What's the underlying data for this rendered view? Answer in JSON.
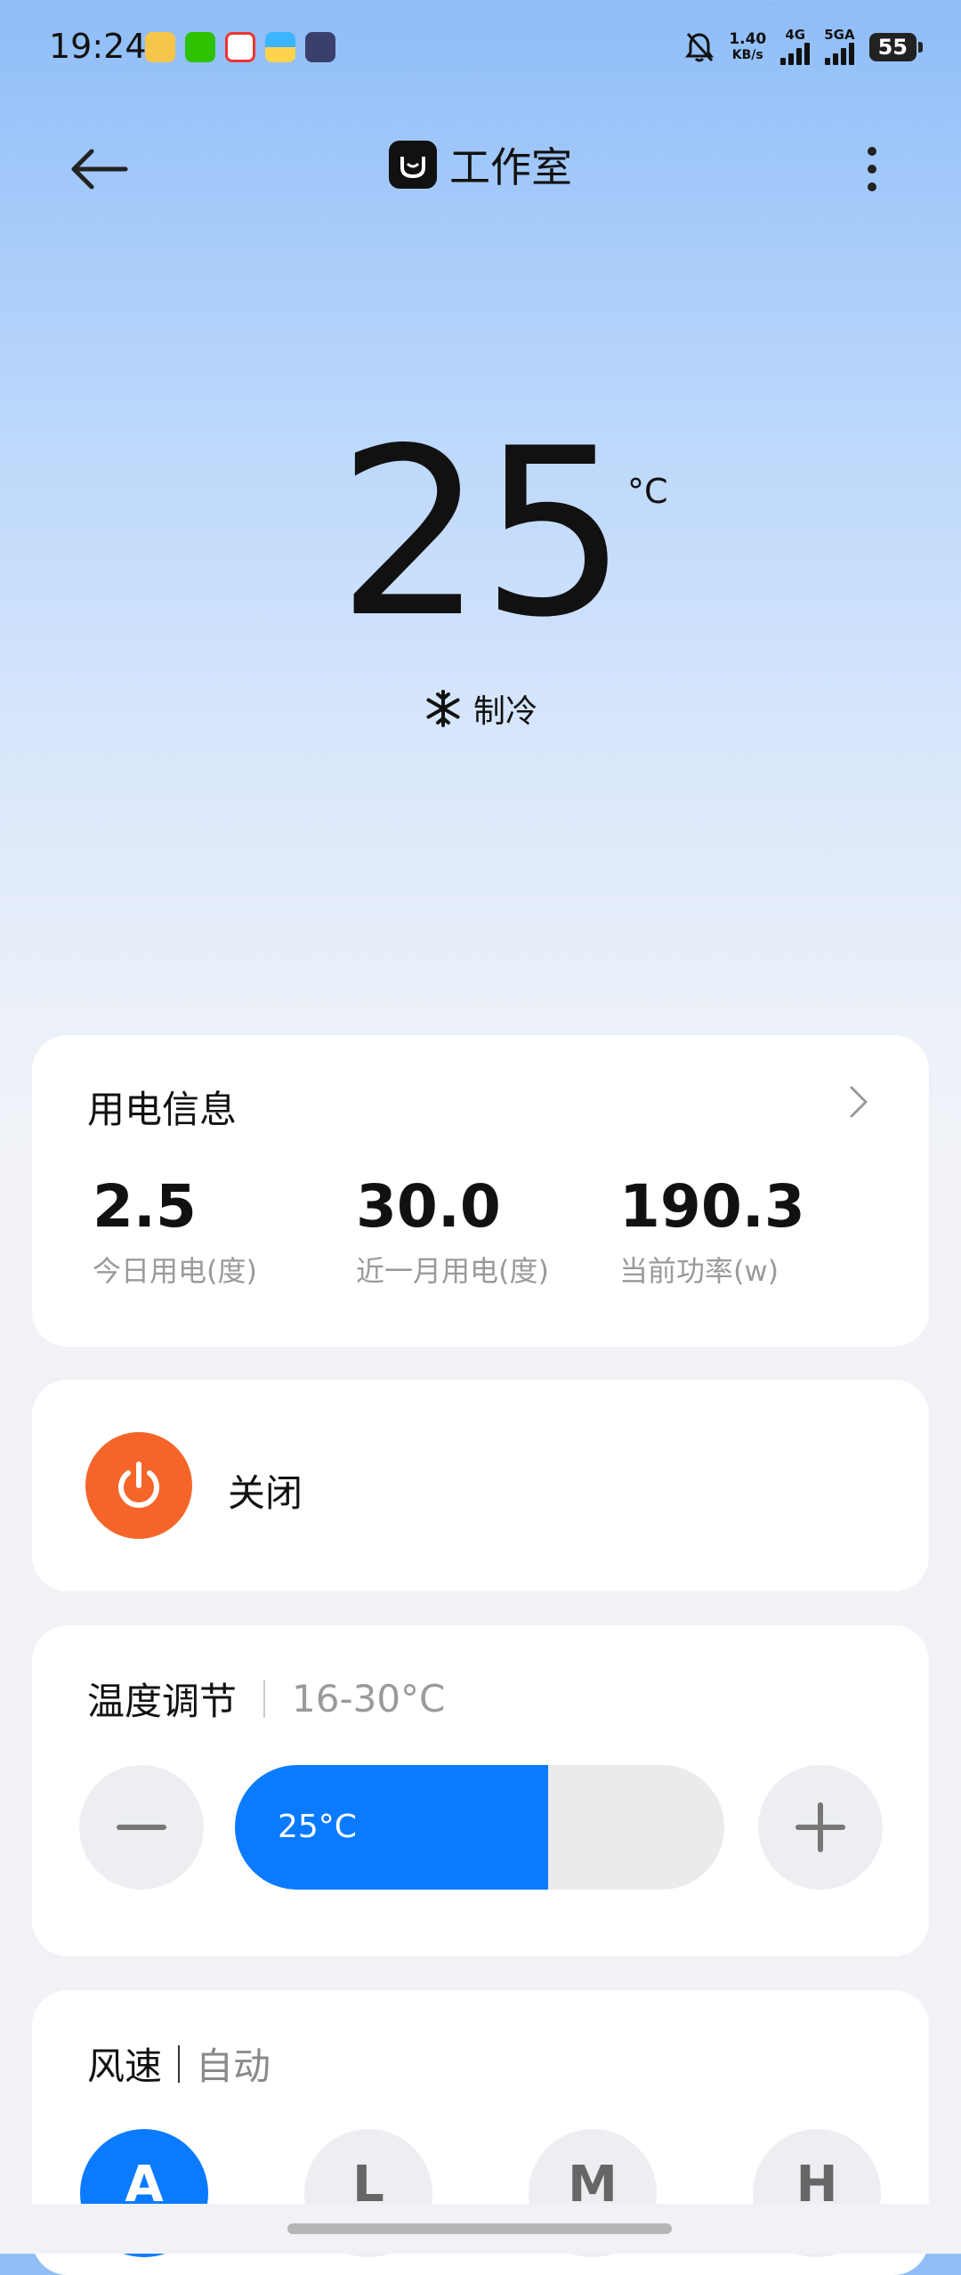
{
  "status_bar": {
    "time": "19:24",
    "net_speed_value": "1.40",
    "net_speed_unit": "KB/s",
    "signal1_label": "4G",
    "signal2_label": "5GA",
    "battery": "55",
    "icons": [
      "weibo-icon",
      "wechat-icon",
      "music-icon",
      "app-icon",
      "video-icon",
      "bell-muted-icon"
    ]
  },
  "header": {
    "title": "工作室",
    "logo": "mi-home-icon"
  },
  "hero": {
    "temperature": "25",
    "unit": "°C",
    "mode": "制冷",
    "mode_icon": "snowflake-icon"
  },
  "energy": {
    "title": "用电信息",
    "stats": [
      {
        "value": "2.5",
        "label": "今日用电(度)"
      },
      {
        "value": "30.0",
        "label": "近一月用电(度)"
      },
      {
        "value": "190.3",
        "label": "当前功率(w)"
      }
    ]
  },
  "power": {
    "label": "关闭",
    "color": "#f5652a"
  },
  "temp_control": {
    "title": "温度调节",
    "range": "16-30°C",
    "current": "25°C",
    "fill_fraction": 0.64,
    "accent": "#0a7bff"
  },
  "fan": {
    "title": "风速",
    "value": "自动",
    "options": [
      "A",
      "L",
      "M",
      "H"
    ],
    "selected": "A"
  }
}
